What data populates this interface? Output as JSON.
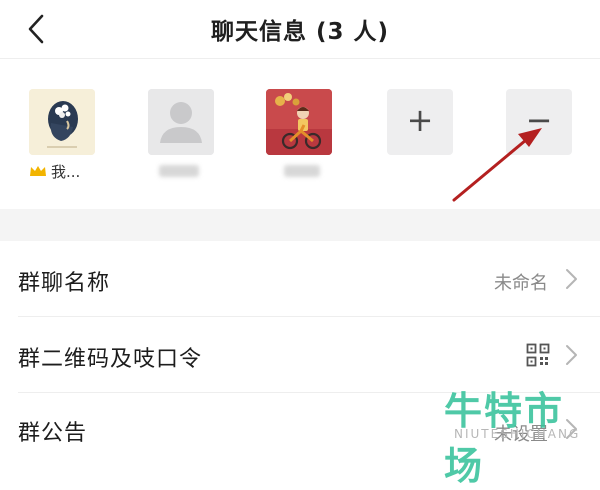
{
  "header": {
    "title": "聊天信息 (3 人)",
    "back_icon": "chevron-left-icon"
  },
  "members": {
    "owner_name": "我...",
    "owner_badge_icon": "crown-icon",
    "add_symbol": "+",
    "remove_symbol": "−"
  },
  "settings": {
    "group_name_label": "群聊名称",
    "group_name_value": "未命名",
    "qr_label": "群二维码及吱口令",
    "notice_label": "群公告",
    "notice_value": "未设置"
  },
  "watermark": {
    "main": "牛特市场",
    "sub": "NIUTESHICHANG"
  },
  "colors": {
    "annotation_arrow": "#b42020",
    "crown": "#f2b400",
    "watermark": "#37c29b"
  }
}
